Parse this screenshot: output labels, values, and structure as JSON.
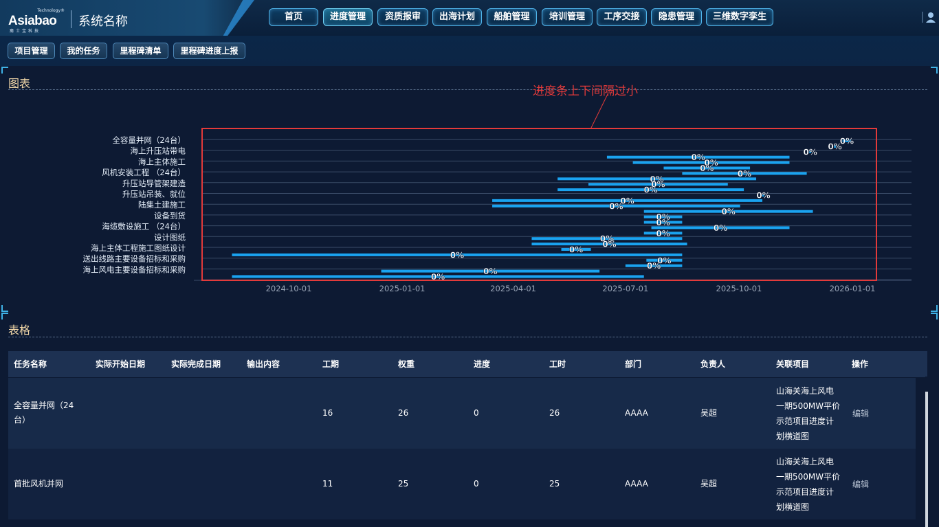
{
  "header": {
    "logo_tech": "Technology®",
    "logo_word": "Asiabao",
    "logo_sub": "裔士宝科技",
    "system_name": "系统名称"
  },
  "nav": {
    "items": [
      {
        "label": "首页",
        "active": false
      },
      {
        "label": "进度管理",
        "active": true
      },
      {
        "label": "资质报审",
        "active": false
      },
      {
        "label": "出海计划",
        "active": false
      },
      {
        "label": "船舶管理",
        "active": false
      },
      {
        "label": "培训管理",
        "active": false
      },
      {
        "label": "工序交接",
        "active": false
      },
      {
        "label": "隐患管理",
        "active": false
      },
      {
        "label": "三维数字孪生",
        "active": false
      }
    ]
  },
  "subnav": {
    "items": [
      "项目管理",
      "我的任务",
      "里程碑清单",
      "里程碑进度上报"
    ]
  },
  "chart_section": {
    "title": "图表",
    "annotation": "进度条上下间隔过小"
  },
  "chart_data": {
    "type": "gantt",
    "title": "",
    "x_axis_type": "date",
    "x_ticks": [
      "2024-10-01",
      "2025-01-01",
      "2025-04-01",
      "2025-07-01",
      "2025-10-01",
      "2026-01-01"
    ],
    "y_labels": [
      "全容量并网（24台）",
      "海上升压站带电",
      "海上主体施工",
      "风机安装工程 （24台）",
      "升压站导管架建造",
      "升压站吊装、就位",
      "陆集土建施工",
      "设备到货",
      "海缆敷设施工 （24台）",
      "设计图纸",
      "海上主体工程施工图纸设计",
      "送出线路主要设备招标和采购",
      "海上风电主要设备招标和采购"
    ],
    "bars": [
      {
        "start": "2025-12-24",
        "end": "2025-12-31",
        "label": "0%"
      },
      {
        "start": "2025-12-17",
        "end": "2025-12-18",
        "label": "0%"
      },
      {
        "start": "2025-11-27",
        "end": "2025-11-28",
        "label": "0%"
      },
      {
        "start": "2025-06-16",
        "end": "2025-11-11",
        "label": "0%"
      },
      {
        "start": "2025-07-07",
        "end": "2025-11-11",
        "label": "0%"
      },
      {
        "start": "2025-08-01",
        "end": "2025-10-10",
        "label": "0%"
      },
      {
        "start": "2025-08-16",
        "end": "2025-11-25",
        "label": "0%"
      },
      {
        "start": "2025-05-07",
        "end": "2025-10-15",
        "label": "0%"
      },
      {
        "start": "2025-06-01",
        "end": "2025-09-22",
        "label": "0%"
      },
      {
        "start": "2025-05-07",
        "end": "2025-10-05",
        "label": "0%"
      },
      {
        "start": "2025-10-20",
        "end": "2025-10-21",
        "label": "0%"
      },
      {
        "start": "2025-03-15",
        "end": "2025-10-20",
        "label": "0%"
      },
      {
        "start": "2025-03-15",
        "end": "2025-10-02",
        "label": "0%"
      },
      {
        "start": "2025-07-16",
        "end": "2025-11-30",
        "label": "0%"
      },
      {
        "start": "2025-07-16",
        "end": "2025-08-16",
        "label": "0%"
      },
      {
        "start": "2025-07-16",
        "end": "2025-08-16",
        "label": "0%"
      },
      {
        "start": "2025-07-22",
        "end": "2025-11-11",
        "label": "0%"
      },
      {
        "start": "2025-07-16",
        "end": "2025-08-16",
        "label": "0%"
      },
      {
        "start": "2025-04-16",
        "end": "2025-08-16",
        "label": "0%"
      },
      {
        "start": "2025-04-16",
        "end": "2025-08-20",
        "label": "0%"
      },
      {
        "start": "2025-05-10",
        "end": "2025-06-03",
        "label": "0%"
      },
      {
        "start": "2024-08-16",
        "end": "2025-08-16",
        "label": "0%"
      },
      {
        "start": "2025-07-18",
        "end": "2025-08-16",
        "label": "0%"
      },
      {
        "start": "2025-07-01",
        "end": "2025-08-16",
        "label": "0%"
      },
      {
        "start": "2024-12-15",
        "end": "2025-06-10",
        "label": "0%"
      },
      {
        "start": "2024-08-16",
        "end": "2025-07-16",
        "label": "0%"
      }
    ],
    "grid": true,
    "bar_color": "#1aa3f0"
  },
  "table_section": {
    "title": "表格",
    "columns": [
      "任务名称",
      "实际开始日期",
      "实际完成日期",
      "输出内容",
      "工期",
      "权重",
      "进度",
      "工时",
      "部门",
      "负责人",
      "关联项目",
      "操作"
    ],
    "rows": [
      {
        "name": [
          "全容量并网（24",
          "台）"
        ],
        "start": "",
        "end": "",
        "output": "",
        "duration": "16",
        "weight": "26",
        "progress": "0",
        "hours": "26",
        "dept": "AAAA",
        "owner": "吴超",
        "project": [
          "山海关海上风电",
          "一期500MW平价",
          "示范项目进度计",
          "划横道图"
        ],
        "action": "编辑"
      },
      {
        "name": [
          "首批风机并网"
        ],
        "start": "",
        "end": "",
        "output": "",
        "duration": "11",
        "weight": "25",
        "progress": "0",
        "hours": "25",
        "dept": "AAAA",
        "owner": "吴超",
        "project": [
          "山海关海上风电",
          "一期500MW平价",
          "示范项目进度计",
          "划横道图"
        ],
        "action": "编辑"
      }
    ]
  }
}
